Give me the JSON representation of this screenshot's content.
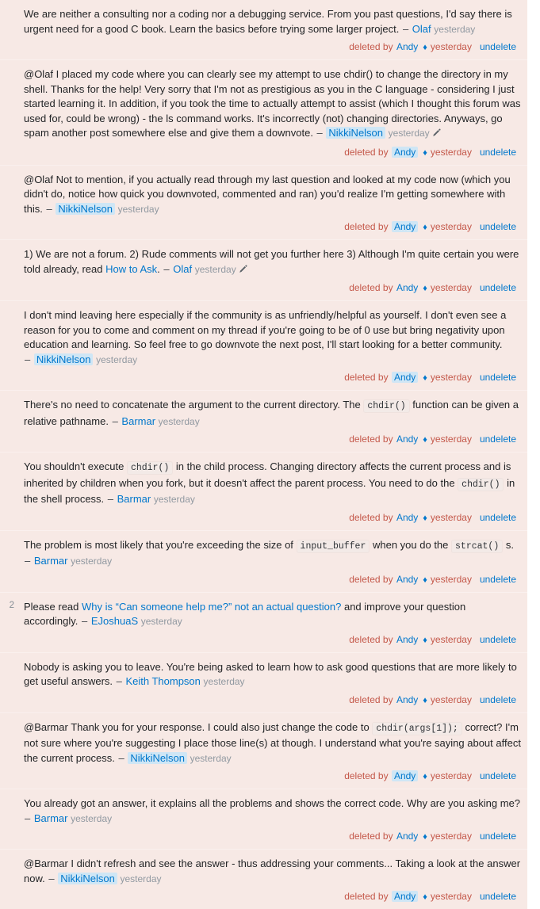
{
  "panel": {
    "accent_link_color": "#0077cc",
    "deleted_text_color": "#c4584a",
    "row_background": "#f7e9e5",
    "highlight_background": "#cfe6f5"
  },
  "labels": {
    "deleted_by": "deleted by",
    "undelete": "undelete",
    "separator": "♦",
    "dash": "–",
    "edit_icon": "pencil-icon"
  },
  "comments": [
    {
      "score": "",
      "segments": [
        {
          "type": "text",
          "value": "We are neither a consulting nor a coding nor a debugging service. From you past questions, I'd say there is urgent need for a good C book. Learn the basics before trying some larger project. "
        }
      ],
      "author": "Olaf",
      "author_highlighted": false,
      "timestamp": "yesterday",
      "edited": false,
      "deleted_by": "Andy",
      "deleted_by_highlighted": false,
      "deleted_timestamp": "yesterday"
    },
    {
      "score": "",
      "segments": [
        {
          "type": "text",
          "value": "@Olaf I placed my code where you can clearly see my attempt to use chdir() to change the directory in my shell. Thanks for the help! Very sorry that I'm not as prestigious as you in the C language - considering I just started learning it. In addition, if you took the time to actually attempt to assist (which I thought this forum was used for, could be wrong) - the ls command works. It's incorrectly (not) changing directories. Anyways, go spam another post somewhere else and give them a downvote. "
        }
      ],
      "author": "NikkiNelson",
      "author_highlighted": true,
      "timestamp": "yesterday",
      "edited": true,
      "deleted_by": "Andy",
      "deleted_by_highlighted": true,
      "deleted_timestamp": "yesterday"
    },
    {
      "score": "",
      "segments": [
        {
          "type": "text",
          "value": "@Olaf Not to mention, if you actually read through my last question and looked at my code now (which you didn't do, notice how quick you downvoted, commented and ran) you'd realize I'm getting somewhere with this. "
        }
      ],
      "author": "NikkiNelson",
      "author_highlighted": true,
      "timestamp": "yesterday",
      "edited": false,
      "deleted_by": "Andy",
      "deleted_by_highlighted": true,
      "deleted_timestamp": "yesterday"
    },
    {
      "score": "",
      "segments": [
        {
          "type": "text",
          "value": "1) We are not a forum. 2) Rude comments will not get you further here 3) Although I'm quite certain you were told already, read "
        },
        {
          "type": "link",
          "value": "How to Ask"
        },
        {
          "type": "text",
          "value": ". "
        }
      ],
      "author": "Olaf",
      "author_highlighted": false,
      "timestamp": "yesterday",
      "edited": true,
      "deleted_by": "Andy",
      "deleted_by_highlighted": false,
      "deleted_timestamp": "yesterday"
    },
    {
      "score": "",
      "segments": [
        {
          "type": "text",
          "value": "I don't mind leaving here especially if the community is as unfriendly/helpful as yourself. I don't even see a reason for you to come and comment on my thread if you're going to be of 0 use but bring negativity upon education and learning. So feel free to go downvote the next post, I'll start looking for a better community. "
        }
      ],
      "author": "NikkiNelson",
      "author_highlighted": true,
      "timestamp": "yesterday",
      "edited": false,
      "deleted_by": "Andy",
      "deleted_by_highlighted": true,
      "deleted_timestamp": "yesterday"
    },
    {
      "score": "",
      "segments": [
        {
          "type": "text",
          "value": "There's no need to concatenate the argument to the current directory. The "
        },
        {
          "type": "code",
          "value": "chdir()"
        },
        {
          "type": "text",
          "value": " function can be given a relative pathname. "
        }
      ],
      "author": "Barmar",
      "author_highlighted": false,
      "timestamp": "yesterday",
      "edited": false,
      "deleted_by": "Andy",
      "deleted_by_highlighted": false,
      "deleted_timestamp": "yesterday"
    },
    {
      "score": "",
      "segments": [
        {
          "type": "text",
          "value": "You shouldn't execute "
        },
        {
          "type": "code",
          "value": "chdir()"
        },
        {
          "type": "text",
          "value": " in the child process. Changing directory affects the current process and is inherited by children when you fork, but it doesn't affect the parent process. You need to do the "
        },
        {
          "type": "code",
          "value": "chdir()"
        },
        {
          "type": "text",
          "value": " in the shell process. "
        }
      ],
      "author": "Barmar",
      "author_highlighted": false,
      "timestamp": "yesterday",
      "edited": false,
      "deleted_by": "Andy",
      "deleted_by_highlighted": false,
      "deleted_timestamp": "yesterday"
    },
    {
      "score": "",
      "segments": [
        {
          "type": "text",
          "value": "The problem is most likely that you're exceeding the size of "
        },
        {
          "type": "code",
          "value": "input_buffer"
        },
        {
          "type": "text",
          "value": " when you do the "
        },
        {
          "type": "code",
          "value": "strcat()"
        },
        {
          "type": "text",
          "value": " s. "
        }
      ],
      "author": "Barmar",
      "author_highlighted": false,
      "timestamp": "yesterday",
      "edited": false,
      "deleted_by": "Andy",
      "deleted_by_highlighted": false,
      "deleted_timestamp": "yesterday"
    },
    {
      "score": "2",
      "segments": [
        {
          "type": "text",
          "value": "Please read "
        },
        {
          "type": "link",
          "value": "Why is “Can someone help me?” not an actual question?"
        },
        {
          "type": "text",
          "value": " and improve your question accordingly. "
        }
      ],
      "author": "EJoshuaS",
      "author_highlighted": false,
      "timestamp": "yesterday",
      "edited": false,
      "deleted_by": "Andy",
      "deleted_by_highlighted": false,
      "deleted_timestamp": "yesterday"
    },
    {
      "score": "",
      "segments": [
        {
          "type": "text",
          "value": "Nobody is asking you to leave. You're being asked to learn how to ask good questions that are more likely to get useful answers. "
        }
      ],
      "author": "Keith Thompson",
      "author_highlighted": false,
      "timestamp": "yesterday",
      "edited": false,
      "deleted_by": "Andy",
      "deleted_by_highlighted": false,
      "deleted_timestamp": "yesterday"
    },
    {
      "score": "",
      "segments": [
        {
          "type": "text",
          "value": "@Barmar Thank you for your response. I could also just change the code to "
        },
        {
          "type": "code",
          "value": "chdir(args[1]);"
        },
        {
          "type": "text",
          "value": " correct? I'm not sure where you're suggesting I place those line(s) at though. I understand what you're saying about affect the current process. "
        }
      ],
      "author": "NikkiNelson",
      "author_highlighted": true,
      "timestamp": "yesterday",
      "edited": false,
      "deleted_by": "Andy",
      "deleted_by_highlighted": true,
      "deleted_timestamp": "yesterday"
    },
    {
      "score": "",
      "segments": [
        {
          "type": "text",
          "value": "You already got an answer, it explains all the problems and shows the correct code. Why are you asking me? "
        }
      ],
      "author": "Barmar",
      "author_highlighted": false,
      "timestamp": "yesterday",
      "edited": false,
      "deleted_by": "Andy",
      "deleted_by_highlighted": false,
      "deleted_timestamp": "yesterday"
    },
    {
      "score": "",
      "segments": [
        {
          "type": "text",
          "value": "@Barmar I didn't refresh and see the answer - thus addressing your comments... Taking a look at the answer now. "
        }
      ],
      "author": "NikkiNelson",
      "author_highlighted": true,
      "timestamp": "yesterday",
      "edited": false,
      "deleted_by": "Andy",
      "deleted_by_highlighted": true,
      "deleted_timestamp": "yesterday"
    }
  ]
}
